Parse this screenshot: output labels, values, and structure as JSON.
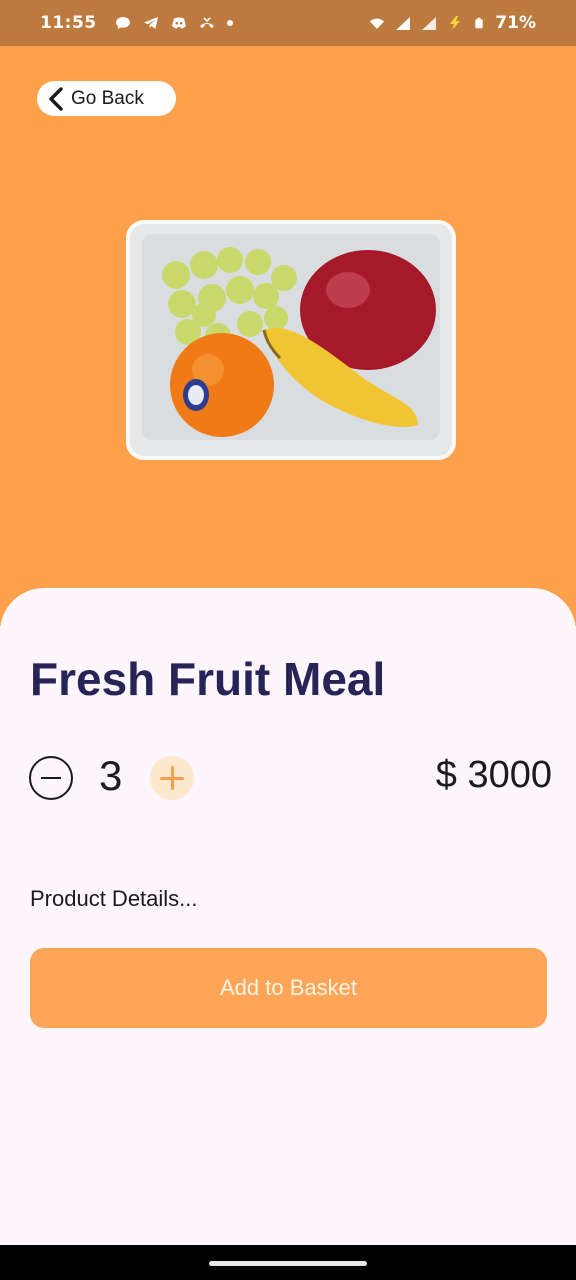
{
  "status_bar": {
    "time": "11:55",
    "battery": "71%",
    "icons": [
      "chat-icon",
      "telegram-icon",
      "discord-icon",
      "missed-call-icon",
      "dot-icon",
      "wifi-icon",
      "signal-icon",
      "signal-icon",
      "charging-icon",
      "battery-icon"
    ]
  },
  "header": {
    "back_label": "Go Back"
  },
  "product": {
    "title": "Fresh Fruit Meal",
    "quantity": "3",
    "price": "$ 3000",
    "details": "Product Details...",
    "add_label": "Add to Basket"
  },
  "colors": {
    "accent": "#ffa04b",
    "status_bar": "#bd7a3e",
    "title": "#272457",
    "background": "#fdf6fd"
  }
}
